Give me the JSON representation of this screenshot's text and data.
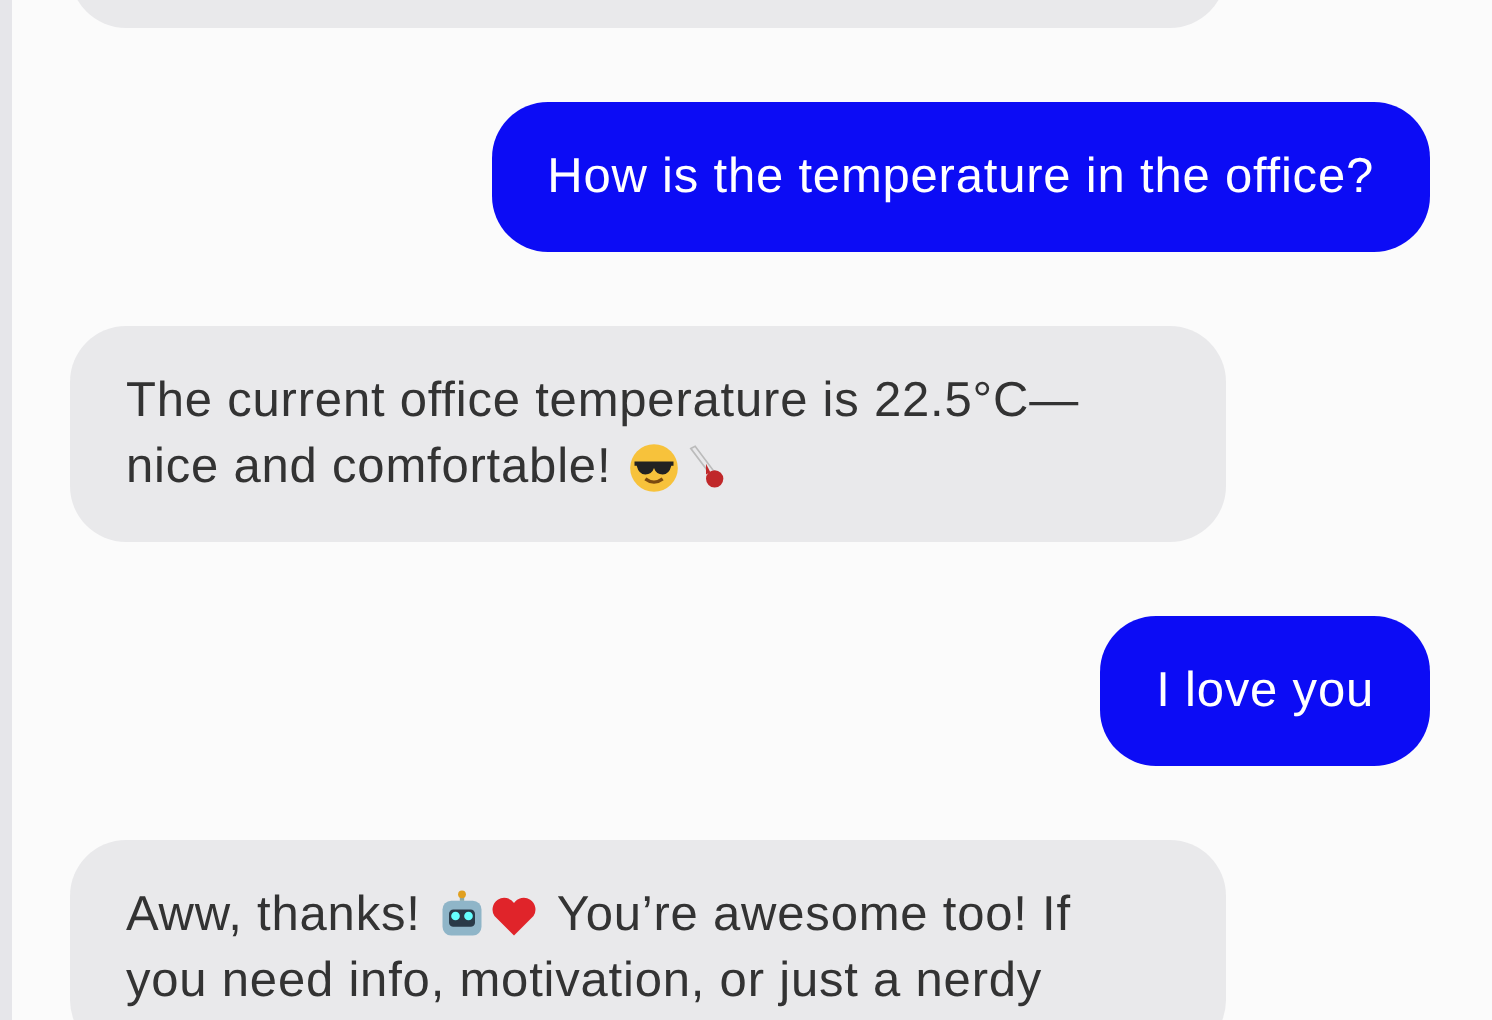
{
  "messages": [
    {
      "kind": "received"
    },
    {
      "kind": "sent",
      "lines": [
        [
          {
            "kind": "text",
            "text": "How is the temperature in the office?"
          }
        ]
      ]
    },
    {
      "kind": "received",
      "lines": [
        [
          {
            "kind": "text",
            "text": "The current office temperature is 22.5°C—"
          }
        ],
        [
          {
            "kind": "text",
            "text": "nice and comfortable!"
          },
          {
            "kind": "emoji"
          },
          {
            "kind": "emoji"
          }
        ]
      ]
    },
    {
      "kind": "sent",
      "lines": [
        [
          {
            "kind": "text",
            "text": "I love you"
          }
        ]
      ]
    },
    {
      "kind": "received",
      "lines": [
        [
          {
            "kind": "text",
            "text": "Aww, thanks!"
          },
          {
            "kind": "emoji"
          },
          {
            "kind": "emoji"
          },
          {
            "kind": "text",
            "text": "You’re awesome too! If"
          }
        ],
        [
          {
            "kind": "text",
            "text": "you need info, motivation, or just a nerdy"
          }
        ]
      ]
    }
  ]
}
